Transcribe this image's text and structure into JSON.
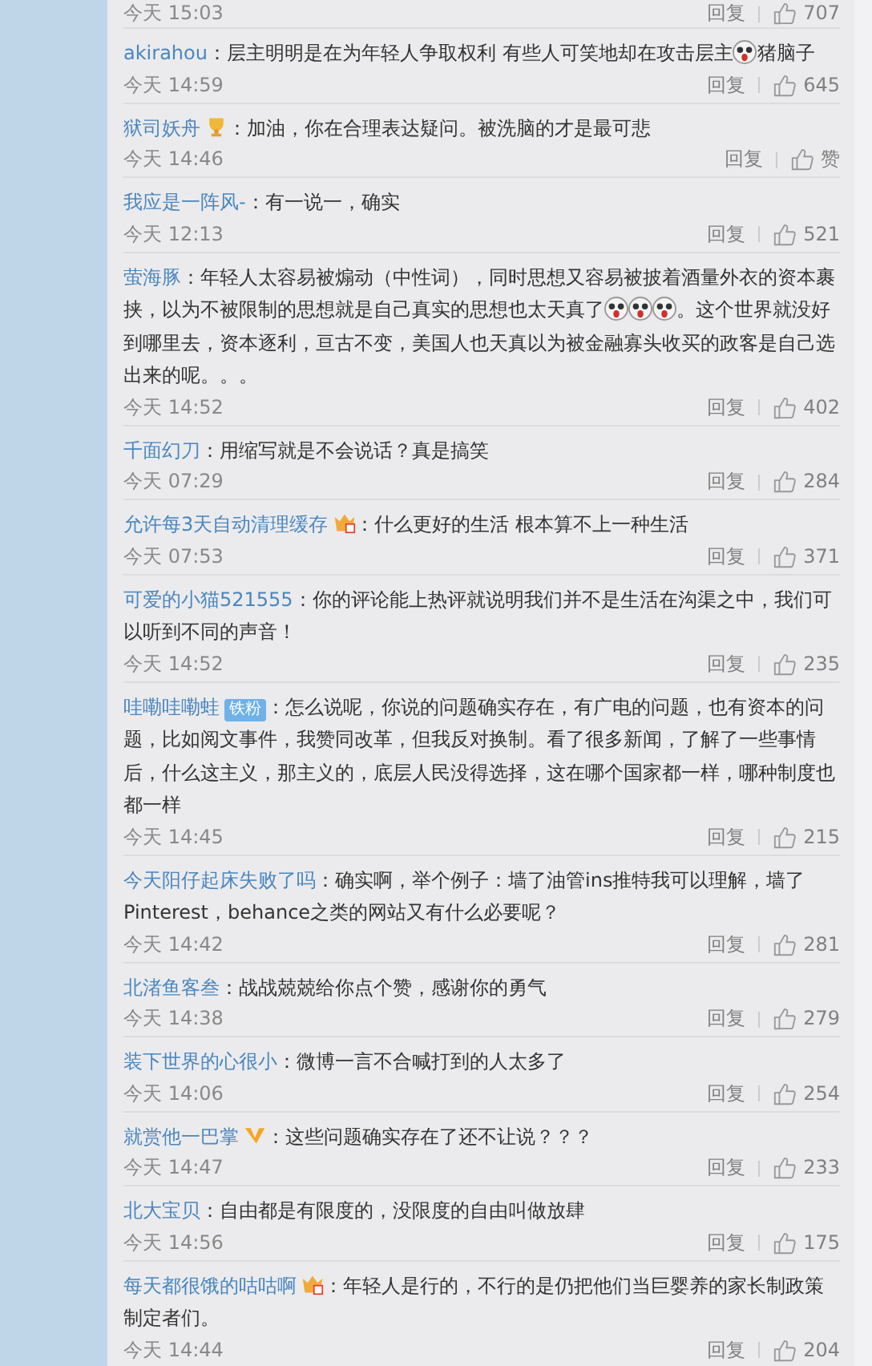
{
  "comments": [
    {
      "kind": "footer_only",
      "time": "今天 15:03",
      "reply": "回复",
      "likes": "707"
    },
    {
      "kind": "comment",
      "user": "akirahou",
      "parts": [
        {
          "kind": "text",
          "text": "：层主明明是在为年轻人争取权利 有些人可笑地却在攻击层主"
        },
        {
          "kind": "emoji"
        },
        {
          "kind": "text",
          "text": "猪脑子"
        }
      ],
      "time": "今天 14:59",
      "reply": "回复",
      "likes": "645"
    },
    {
      "kind": "comment",
      "user": "狱司妖舟",
      "badge": {
        "kind": "trophy"
      },
      "parts": [
        {
          "kind": "text",
          "text": "：加油，你在合理表达疑问。被洗脑的才是最可悲"
        }
      ],
      "time": "今天 14:46",
      "reply": "回复",
      "likes": "赞"
    },
    {
      "kind": "comment",
      "user": "我应是一阵风-",
      "parts": [
        {
          "kind": "text",
          "text": "：有一说一，确实"
        }
      ],
      "time": "今天 12:13",
      "reply": "回复",
      "likes": "521"
    },
    {
      "kind": "comment",
      "user": "萤海豚",
      "parts": [
        {
          "kind": "text",
          "text": "：年轻人太容易被煽动（中性词），同时思想又容易被披着酒量外衣的资本裹挟，以为不被限制的思想就是自己真实的思想也太天真了"
        },
        {
          "kind": "emoji"
        },
        {
          "kind": "emoji"
        },
        {
          "kind": "emoji"
        },
        {
          "kind": "text",
          "text": "。这个世界就没好到哪里去，资本逐利，亘古不变，美国人也天真以为被金融寡头收买的政客是自己选出来的呢。。。"
        }
      ],
      "time": "今天 14:52",
      "reply": "回复",
      "likes": "402"
    },
    {
      "kind": "comment",
      "user": "千面幻刀",
      "parts": [
        {
          "kind": "text",
          "text": "：用缩写就是不会说话？真是搞笑"
        }
      ],
      "time": "今天 07:29",
      "reply": "回复",
      "likes": "284"
    },
    {
      "kind": "comment",
      "user": "允许每3天自动清理缓存",
      "badge": {
        "kind": "crown"
      },
      "parts": [
        {
          "kind": "text",
          "text": "：什么更好的生活 根本算不上一种生活"
        }
      ],
      "time": "今天 07:53",
      "reply": "回复",
      "likes": "371"
    },
    {
      "kind": "comment",
      "user": "可爱的小猫521555",
      "parts": [
        {
          "kind": "text",
          "text": "：你的评论能上热评就说明我们并不是生活在沟渠之中，我们可以听到不同的声音！"
        }
      ],
      "time": "今天 14:52",
      "reply": "回复",
      "likes": "235"
    },
    {
      "kind": "comment",
      "user": "哇嘞哇嘞蛙",
      "badge": {
        "kind": "label",
        "text": "铁粉"
      },
      "parts": [
        {
          "kind": "text",
          "text": "：怎么说呢，你说的问题确实存在，有广电的问题，也有资本的问题，比如阅文事件，我赞同改革，但我反对换制。看了很多新闻，了解了一些事情后，什么这主义，那主义的，底层人民没得选择，这在哪个国家都一样，哪种制度也都一样"
        }
      ],
      "time": "今天 14:45",
      "reply": "回复",
      "likes": "215"
    },
    {
      "kind": "comment",
      "user": "今天阳仔起床失败了吗",
      "parts": [
        {
          "kind": "text",
          "text": "：确实啊，举个例子：墙了油管ins推特我可以理解，墙了Pinterest，behance之类的网站又有什么必要呢？"
        }
      ],
      "time": "今天 14:42",
      "reply": "回复",
      "likes": "281"
    },
    {
      "kind": "comment",
      "user": "北渚鱼客叁",
      "parts": [
        {
          "kind": "text",
          "text": "：战战兢兢给你点个赞，感谢你的勇气"
        }
      ],
      "time": "今天 14:38",
      "reply": "回复",
      "likes": "279"
    },
    {
      "kind": "comment",
      "user": "装下世界的心很小",
      "parts": [
        {
          "kind": "text",
          "text": "：微博一言不合喊打到的人太多了"
        }
      ],
      "time": "今天 14:06",
      "reply": "回复",
      "likes": "254"
    },
    {
      "kind": "comment",
      "user": "就赏他一巴掌",
      "badge": {
        "kind": "vip"
      },
      "parts": [
        {
          "kind": "text",
          "text": "：这些问题确实存在了还不让说？？？"
        }
      ],
      "time": "今天 14:47",
      "reply": "回复",
      "likes": "233"
    },
    {
      "kind": "comment",
      "user": "北大宝贝",
      "parts": [
        {
          "kind": "text",
          "text": "：自由都是有限度的，没限度的自由叫做放肆"
        }
      ],
      "time": "今天 14:56",
      "reply": "回复",
      "likes": "175"
    },
    {
      "kind": "comment",
      "user": "每天都很饿的咕咕啊",
      "badge": {
        "kind": "crown"
      },
      "parts": [
        {
          "kind": "text",
          "text": "：年轻人是行的，不行的是仍把他们当巨婴养的家长制政策制定者们。"
        }
      ],
      "time": "今天 14:44",
      "reply": "回复",
      "likes": "204"
    }
  ]
}
